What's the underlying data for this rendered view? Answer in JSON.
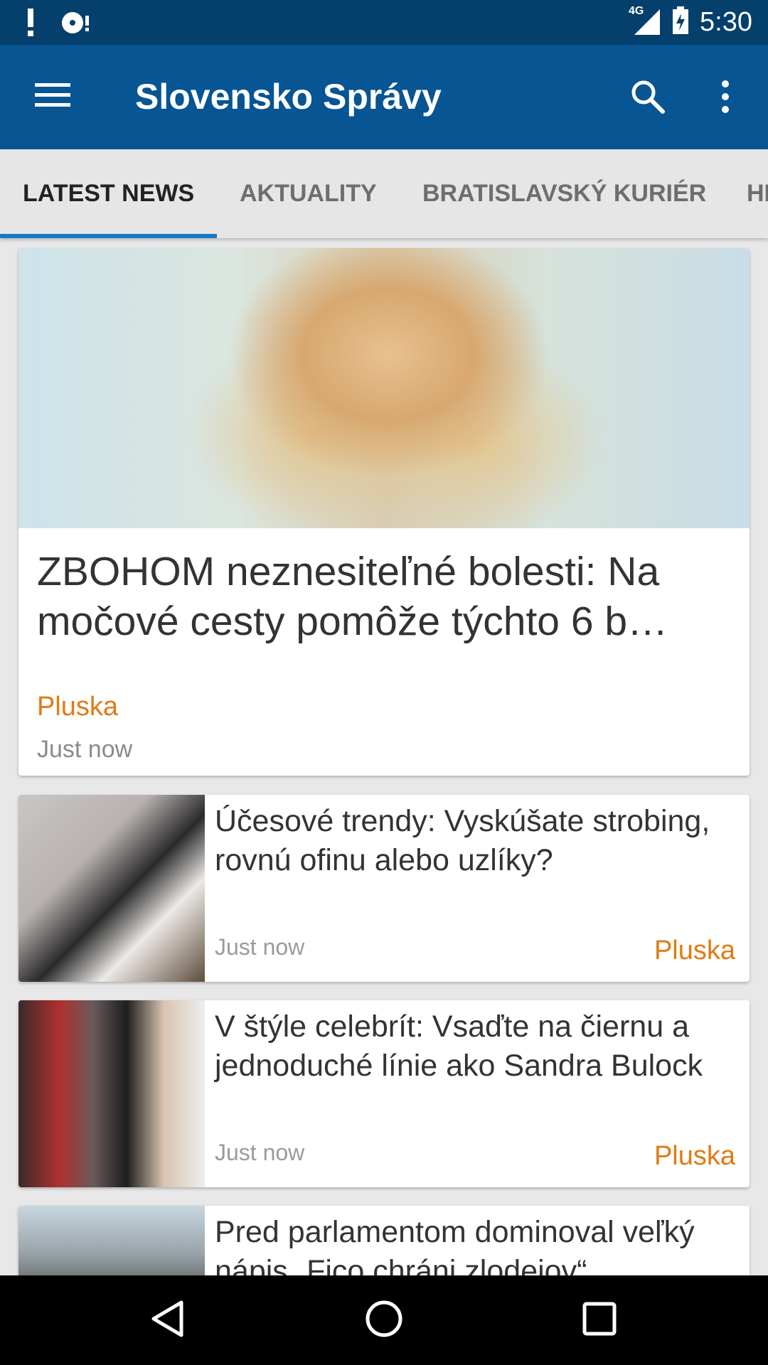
{
  "status_bar": {
    "time": "5:30",
    "network": "4G",
    "icons": [
      "alert-icon",
      "disc-alert-icon",
      "signal-icon",
      "battery-icon"
    ]
  },
  "app_bar": {
    "title": "Slovensko Správy",
    "icons": [
      "menu-icon",
      "search-icon",
      "more-vert-icon"
    ]
  },
  "tabs": [
    {
      "label": "LATEST NEWS",
      "active": true
    },
    {
      "label": "AKTUALITY",
      "active": false
    },
    {
      "label": "BRATISLAVSKÝ KURIÉR",
      "active": false
    },
    {
      "label": "HI",
      "active": false
    }
  ],
  "articles": {
    "featured": {
      "title": "ZBOHOM neznesiteľné bolesti: Na močové cesty pomôže týchto 6 b…",
      "source": "Pluska",
      "time": "Just now"
    },
    "list": [
      {
        "title": "Účesové trendy: Vyskúšate strobing, rovnú ofinu alebo uzlíky?",
        "time": "Just now",
        "source": "Pluska"
      },
      {
        "title": "V štýle celebrít: Vsaďte na čiernu a jednoduché línie ako Sandra Bulock",
        "time": "Just now",
        "source": "Pluska"
      },
      {
        "title": "Pred parlamentom dominoval veľký nápis „Fico chráni zlodejov“",
        "time": "",
        "source": ""
      }
    ]
  },
  "colors": {
    "status_bar": "#053f6c",
    "app_bar": "#075592",
    "tab_indicator": "#1878c8",
    "source_accent": "#e07b14"
  },
  "nav_bar": {
    "icons": [
      "back-icon",
      "home-icon",
      "recents-icon"
    ]
  }
}
